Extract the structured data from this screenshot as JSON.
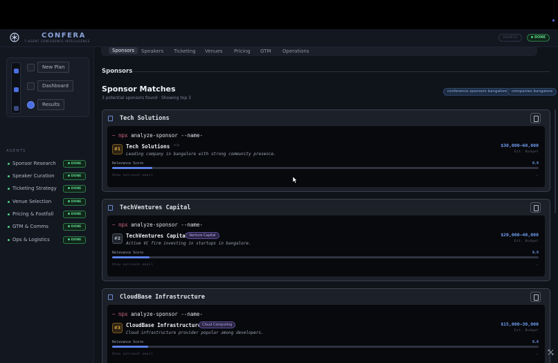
{
  "header": {
    "brand": "CONFERA",
    "tagline": "7-AGENT CONFERENCE INTELLIGENCE",
    "pill_secondary": "AGENTS",
    "status": "DONE"
  },
  "stepper": {
    "steps": [
      {
        "label": "New Plan",
        "state": "inactive"
      },
      {
        "label": "Dashboard",
        "state": "inactive"
      },
      {
        "label": "Results",
        "state": "active"
      }
    ]
  },
  "agents": {
    "label": "AGENTS",
    "items": [
      {
        "name": "Sponsor Research",
        "status": "DONE"
      },
      {
        "name": "Speaker Curation",
        "status": "DONE"
      },
      {
        "name": "Ticketing Strategy",
        "status": "DONE"
      },
      {
        "name": "Venue Selection",
        "status": "DONE"
      },
      {
        "name": "Pricing & Footfall",
        "status": "DONE"
      },
      {
        "name": "GTM & Comms",
        "status": "DONE"
      },
      {
        "name": "Ops & Logistics",
        "status": "DONE"
      }
    ]
  },
  "tabs": [
    "Sponsors",
    "Speakers",
    "Ticketing",
    "Venues",
    "Pricing",
    "GTM",
    "Operations"
  ],
  "active_tab": "Sponsors",
  "section": {
    "heading": "Sponsors",
    "title": "Sponsor Matches",
    "subtitle": "3 potential sponsors found · Showing top 3",
    "chips": [
      "conference sponsors bangalore",
      "companies bangalore"
    ]
  },
  "sponsors": [
    {
      "card_title": "Tech Solutions",
      "command_prompt": "~",
      "command_tool": "npx",
      "command_rest": "analyze-sponsor --name-",
      "rank": "#1",
      "name": "Tech Solutions",
      "tag": "n/a",
      "description": "Leading company in bangalore with strong community presence.",
      "amount": "$30,000–60,000",
      "amount_label": "Est. Budget",
      "relevance_label": "Relevance Score",
      "relevance": 0.9,
      "relevance_text": "0.9",
      "outreach": "Show outreach email"
    },
    {
      "card_title": "TechVentures Capital",
      "command_prompt": "~",
      "command_tool": "npx",
      "command_rest": "analyze-sponsor --name-",
      "rank": "#2",
      "name": "TechVentures Capital",
      "tag": "Venture Capital",
      "description": "Active VC firm investing in startups in bangalore.",
      "amount": "$20,000–40,000",
      "amount_label": "Est. Budget",
      "relevance_label": "Relevance Score",
      "relevance": 0.9,
      "relevance_text": "0.9",
      "outreach": "Show outreach email"
    },
    {
      "card_title": "CloudBase Infrastructure",
      "command_prompt": "~",
      "command_tool": "npx",
      "command_rest": "analyze-sponsor --name-",
      "rank": "#3",
      "name": "CloudBase Infrastructure",
      "tag": "Cloud Computing",
      "description": "Cloud infrastructure provider popular among developers.",
      "amount": "$15,000–30,000",
      "amount_label": "Est. Budget",
      "relevance_label": "Relevance Score",
      "relevance": 0.8,
      "relevance_text": "0.8",
      "outreach": "Show outreach email"
    }
  ],
  "colors": {
    "accent": "#5b7fe8",
    "success": "#4fd082",
    "background": "#0f131a"
  }
}
